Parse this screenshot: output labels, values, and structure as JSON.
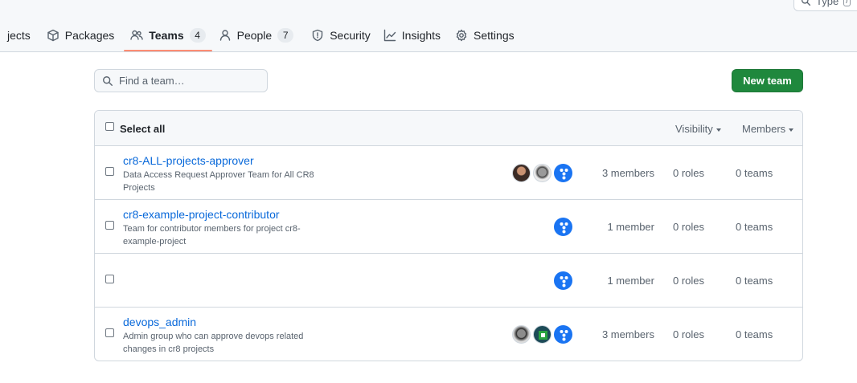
{
  "top_search": {
    "placeholder": "Type",
    "shortcut": "/"
  },
  "nav": {
    "items": [
      {
        "label": "jects",
        "icon": "repo-icon"
      },
      {
        "label": "Packages",
        "icon": "package-icon"
      },
      {
        "label": "Teams",
        "icon": "people-icon",
        "count": "4",
        "active": true
      },
      {
        "label": "People",
        "icon": "person-icon",
        "count": "7"
      },
      {
        "label": "Security",
        "icon": "shield-icon"
      },
      {
        "label": "Insights",
        "icon": "graph-icon"
      },
      {
        "label": "Settings",
        "icon": "gear-icon"
      }
    ]
  },
  "toolbar": {
    "find_placeholder": "Find a team…",
    "new_team_label": "New team",
    "accent_color": "#1f883d"
  },
  "table": {
    "select_all_label": "Select all",
    "visibility_label": "Visibility",
    "members_label": "Members",
    "rows": [
      {
        "name": "cr8-ALL-projects-approver",
        "description": "Data Access Request Approver Team for All CR8 Projects",
        "avatars": [
          "user-avatar",
          "user-avatar",
          "bot-avatar"
        ],
        "members": "3 members",
        "roles": "0 roles",
        "teams": "0 teams"
      },
      {
        "name": "cr8-example-project-contributor",
        "description": "Team for contributor members for project cr8-example-project",
        "avatars": [
          "bot-avatar"
        ],
        "members": "1 member",
        "roles": "0 roles",
        "teams": "0 teams"
      },
      {
        "name": "",
        "description": "",
        "avatars": [
          "bot-avatar"
        ],
        "members": "1 member",
        "roles": "0 roles",
        "teams": "0 teams"
      },
      {
        "name": "devops_admin",
        "description": "Admin group who can approve devops related changes in cr8 projects",
        "avatars": [
          "user-avatar",
          "app-avatar",
          "bot-avatar"
        ],
        "members": "3 members",
        "roles": "0 roles",
        "teams": "0 teams"
      }
    ]
  }
}
